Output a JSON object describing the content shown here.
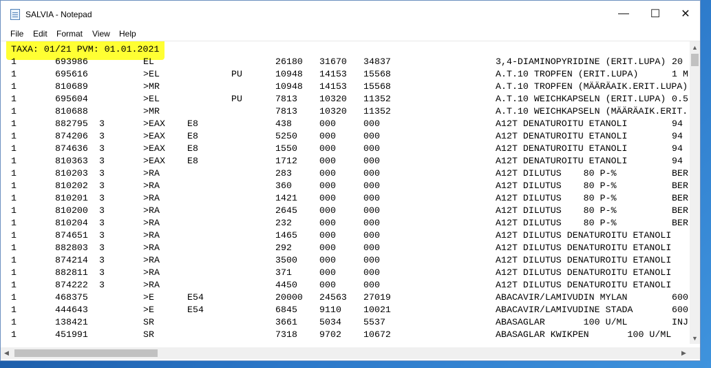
{
  "window": {
    "title": "SALVIA - Notepad",
    "controls": {
      "minimize": "—",
      "maximize": "☐",
      "close": "✕"
    }
  },
  "menu": [
    "File",
    "Edit",
    "Format",
    "View",
    "Help"
  ],
  "header_line": "TAXA: 01/21 PVM: 01.01.2021",
  "columns": [
    "c1",
    "c2",
    "c3",
    "c4",
    "c5",
    "c6",
    "c7",
    "c8",
    "c9",
    "c10",
    "c11"
  ],
  "rows": [
    [
      "1",
      "693986",
      "",
      "EL",
      "",
      "",
      "26180",
      "31670",
      "34837",
      "3,4-DIAMINOPYRIDINE (ERIT.LUPA)",
      "20"
    ],
    [
      "1",
      "695616",
      "",
      ">EL",
      "",
      "PU",
      "10948",
      "14153",
      "15568",
      "A.T.10 TROPFEN (ERIT.LUPA)",
      "1 M"
    ],
    [
      "1",
      "810689",
      "",
      ">MR",
      "",
      "",
      "10948",
      "14153",
      "15568",
      "A.T.10 TROPFEN (MÄÄRÄAIK.ERIT.LUPA)",
      ""
    ],
    [
      "1",
      "695604",
      "",
      ">EL",
      "",
      "PU",
      "7813",
      "10320",
      "11352",
      "A.T.10 WEICHKAPSELN (ERIT.LUPA)",
      "0.5"
    ],
    [
      "1",
      "810688",
      "",
      ">MR",
      "",
      "",
      "7813",
      "10320",
      "11352",
      "A.T.10 WEICHKAPSELN (MÄÄRÄAIK.ERIT.",
      ""
    ],
    [
      "1",
      "882795",
      "3",
      ">EAX",
      "E8",
      "",
      "438",
      "000",
      "000",
      "A12T DENATUROITU ETANOLI",
      "94"
    ],
    [
      "1",
      "874206",
      "3",
      ">EAX",
      "E8",
      "",
      "5250",
      "000",
      "000",
      "A12T DENATUROITU ETANOLI",
      "94"
    ],
    [
      "1",
      "874636",
      "3",
      ">EAX",
      "E8",
      "",
      "1550",
      "000",
      "000",
      "A12T DENATUROITU ETANOLI",
      "94"
    ],
    [
      "1",
      "810363",
      "3",
      ">EAX",
      "E8",
      "",
      "1712",
      "000",
      "000",
      "A12T DENATUROITU ETANOLI",
      "94"
    ],
    [
      "1",
      "810203",
      "3",
      ">RA",
      "",
      "",
      "283",
      "000",
      "000",
      "A12T DILUTUS    80 P-%",
      "BER"
    ],
    [
      "1",
      "810202",
      "3",
      ">RA",
      "",
      "",
      "360",
      "000",
      "000",
      "A12T DILUTUS    80 P-%",
      "BER"
    ],
    [
      "1",
      "810201",
      "3",
      ">RA",
      "",
      "",
      "1421",
      "000",
      "000",
      "A12T DILUTUS    80 P-%",
      "BER"
    ],
    [
      "1",
      "810200",
      "3",
      ">RA",
      "",
      "",
      "2645",
      "000",
      "000",
      "A12T DILUTUS    80 P-%",
      "BER"
    ],
    [
      "1",
      "810204",
      "3",
      ">RA",
      "",
      "",
      "232",
      "000",
      "000",
      "A12T DILUTUS    80 P-%",
      "BER"
    ],
    [
      "1",
      "874651",
      "3",
      ">RA",
      "",
      "",
      "1465",
      "000",
      "000",
      "A12T DILUTUS DENATUROITU ETANOLI",
      ""
    ],
    [
      "1",
      "882803",
      "3",
      ">RA",
      "",
      "",
      "292",
      "000",
      "000",
      "A12T DILUTUS DENATUROITU ETANOLI",
      ""
    ],
    [
      "1",
      "874214",
      "3",
      ">RA",
      "",
      "",
      "3500",
      "000",
      "000",
      "A12T DILUTUS DENATUROITU ETANOLI",
      ""
    ],
    [
      "1",
      "882811",
      "3",
      ">RA",
      "",
      "",
      "371",
      "000",
      "000",
      "A12T DILUTUS DENATUROITU ETANOLI",
      ""
    ],
    [
      "1",
      "874222",
      "3",
      ">RA",
      "",
      "",
      "4450",
      "000",
      "000",
      "A12T DILUTUS DENATUROITU ETANOLI",
      ""
    ],
    [
      "1",
      "468375",
      "",
      ">E",
      "E54",
      "",
      "20000",
      "24563",
      "27019",
      "ABACAVIR/LAMIVUDIN MYLAN",
      "600"
    ],
    [
      "1",
      "444643",
      "",
      ">E",
      "E54",
      "",
      "6845",
      "9110",
      "10021",
      "ABACAVIR/LAMIVUDINE STADA",
      "600"
    ],
    [
      "1",
      "138421",
      "",
      "SR",
      "",
      "",
      "3661",
      "5034",
      "5537",
      "ABASAGLAR       100 U/ML",
      "INJ"
    ],
    [
      "1",
      "451991",
      "",
      "SR",
      "",
      "",
      "7318",
      "9702",
      "10672",
      "ABASAGLAR KWIKPEN       100 U/ML",
      ""
    ]
  ],
  "scroll": {
    "up": "▲",
    "down": "▼",
    "left": "◀",
    "right": "▶"
  },
  "colors": {
    "highlight": "#ffff33",
    "scrollbar_thumb": "#c1c1c1"
  }
}
